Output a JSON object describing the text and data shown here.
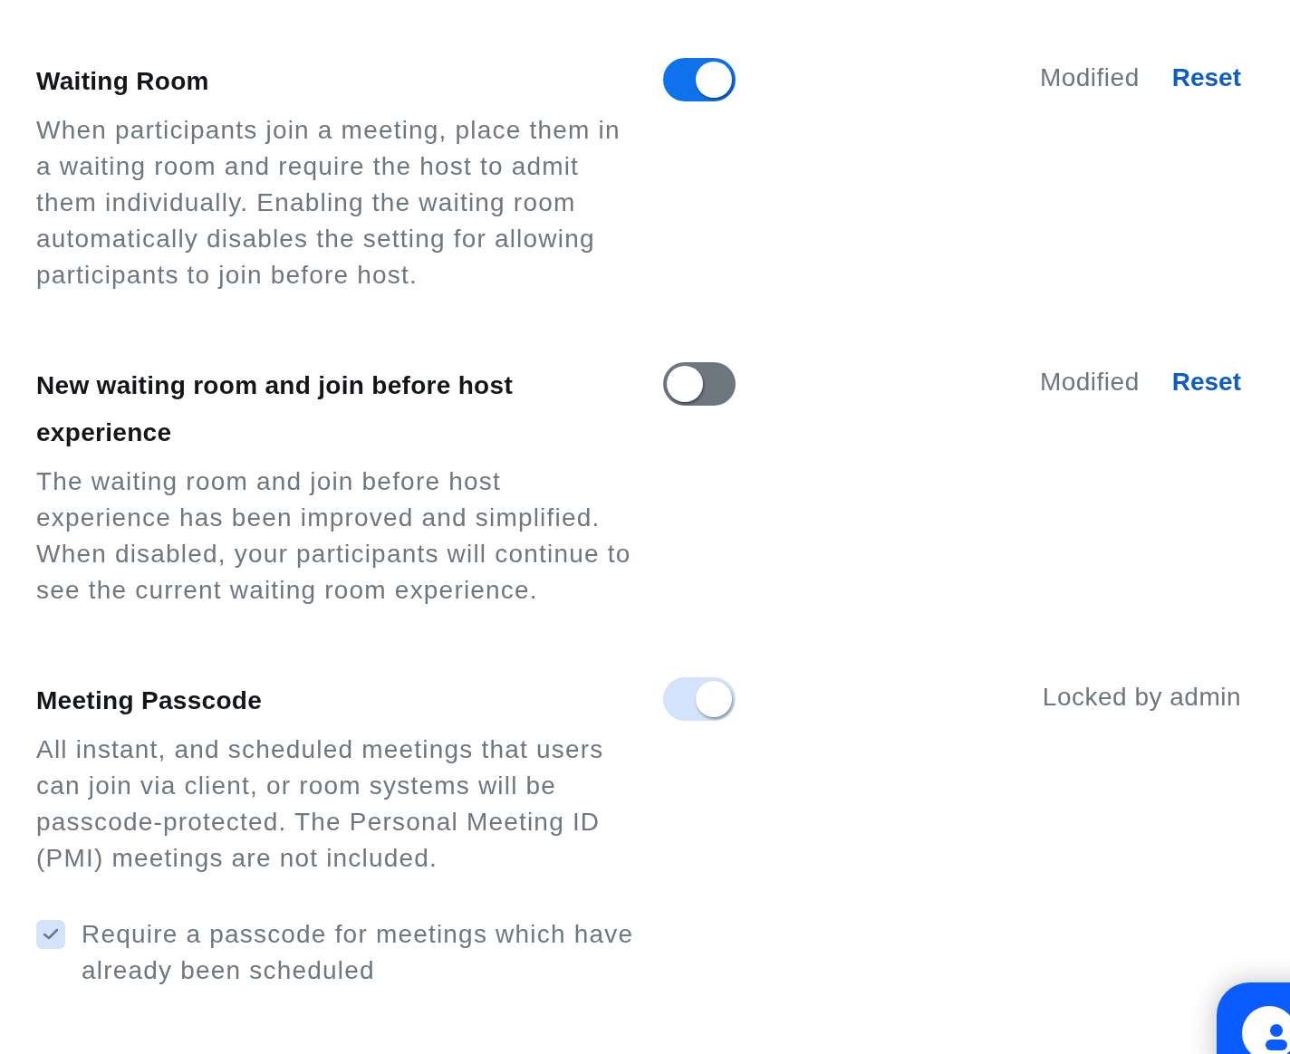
{
  "settings": [
    {
      "title": "Waiting Room",
      "description": "When participants join a meeting, place them in a waiting room and require the host to admit them individually. Enabling the waiting room automatically disables the setting for allowing participants to join before host.",
      "on": true,
      "disabled": false,
      "status": "Modified",
      "reset": "Reset"
    },
    {
      "title": "New waiting room and join before host experience",
      "description": "The waiting room and join before host experience has been improved and simplified. When disabled, your participants will continue to see the current waiting room experience.",
      "on": false,
      "disabled": false,
      "status": "Modified",
      "reset": "Reset"
    },
    {
      "title": "Meeting Passcode",
      "description": "All instant, and scheduled meetings that users can join via client, or room systems will be passcode-protected. The Personal Meeting ID (PMI) meetings are not included.",
      "on": true,
      "disabled": true,
      "status": "Locked by admin",
      "options": [
        {
          "label": "Require a passcode for meetings which have already been scheduled",
          "checked": true,
          "disabled": true
        }
      ]
    }
  ]
}
